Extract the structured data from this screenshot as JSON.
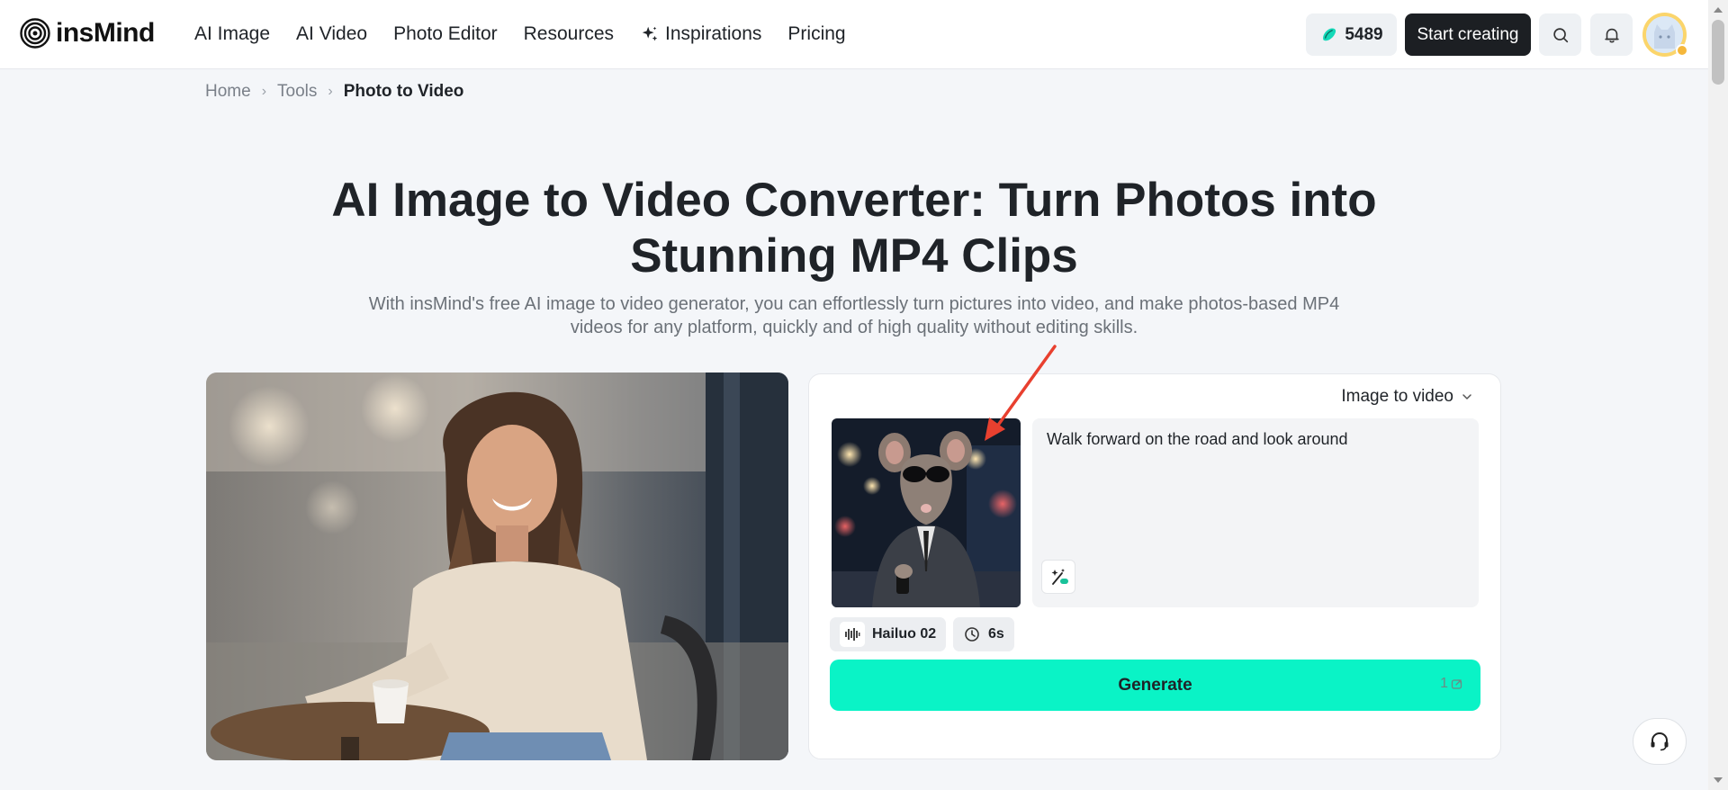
{
  "brand": {
    "name": "insMind"
  },
  "nav": {
    "items": [
      {
        "label": "AI Image"
      },
      {
        "label": "AI Video"
      },
      {
        "label": "Photo Editor"
      },
      {
        "label": "Resources"
      },
      {
        "label": "Inspirations",
        "icon": "sparkle-icon"
      },
      {
        "label": "Pricing"
      }
    ]
  },
  "header": {
    "credits": "5489",
    "start_label": "Start creating"
  },
  "breadcrumb": {
    "home": "Home",
    "tools": "Tools",
    "current": "Photo to Video"
  },
  "hero": {
    "title_line1": "AI Image to Video Converter: Turn Photos into",
    "title_line2": "Stunning MP4 Clips",
    "subtitle_line1": "With insMind's free AI image to video generator, you can effortlessly turn pictures into video, and make photos-based MP4",
    "subtitle_line2": "videos for any platform, quickly and of high quality without editing skills."
  },
  "panel": {
    "mode": "Image to video",
    "prompt": "Walk forward on the road and look around",
    "model": "Hailuo 02",
    "duration": "6s",
    "generate_label": "Generate",
    "generate_cost": "1"
  },
  "colors": {
    "accent": "#0af3c6",
    "dark": "#1c1f23",
    "annotation": "#e8402f"
  }
}
